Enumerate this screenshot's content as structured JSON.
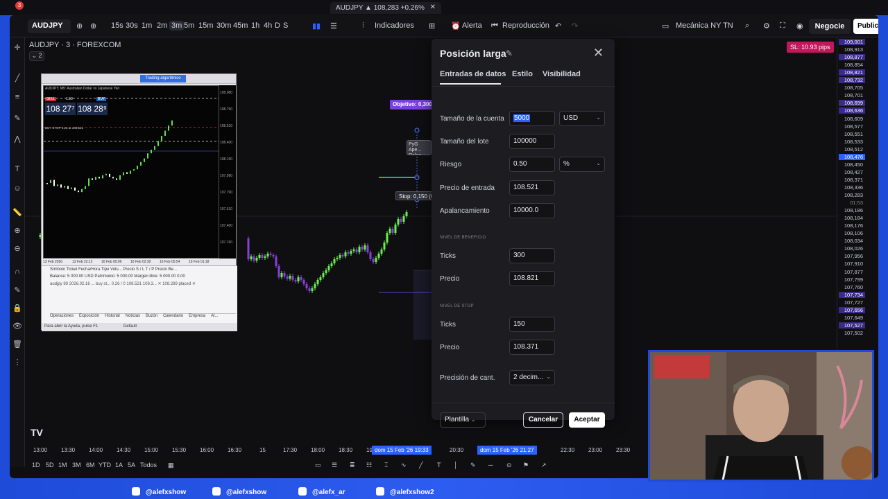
{
  "browser": {
    "tab_title": "AUDJPY ▲ 108,283 +0.26%",
    "notif_count": "3"
  },
  "toolbar": {
    "symbol": "AUDJPY",
    "timeframes": [
      "15s",
      "30s",
      "1m",
      "2m",
      "3m",
      "5m",
      "15m",
      "30m",
      "45m",
      "1h",
      "4h",
      "D",
      "S"
    ],
    "active_tf": "3m",
    "indicators_label": "Indicadores",
    "alert_label": "Alerta",
    "replay_label": "Reproducción",
    "layout_name": "Mecánica NY TN",
    "trade_label": "Negocie",
    "publish_label": "Publica"
  },
  "chart": {
    "title": "AUDJPY · 3 · FOREXCOM",
    "collapse_count": "2",
    "objective_label": "Objetivo: 0,300",
    "stop_label": "Stop: 0,150 (0",
    "pyg_label": "PyG Ape... Relac...",
    "sl_badge": "SL: 10.93 pips",
    "price_labels": [
      "109,001",
      "108,913",
      "108,877",
      "108,854",
      "108,821",
      "108,732",
      "108,705",
      "108,701",
      "108,699",
      "108,636",
      "108,609",
      "108,577",
      "108,551",
      "108,533",
      "108,512",
      "108,476",
      "108,450",
      "108,427",
      "108,371",
      "108,336",
      "108,283",
      "01:53",
      "108,186",
      "108,184",
      "108,176",
      "108,106",
      "108,034",
      "108,026",
      "107,956",
      "107,910",
      "107,877",
      "107,799",
      "107,760",
      "107,734",
      "107,727",
      "107,656",
      "107,649",
      "107,527",
      "107,502"
    ],
    "time_labels": [
      "13:00",
      "13:30",
      "14:00",
      "14:30",
      "15:00",
      "15:30",
      "16:00",
      "16:30",
      "15",
      "17:30",
      "18:00",
      "18:30",
      "19",
      "20:30",
      "21",
      "22:30",
      "23:00",
      "23:30"
    ],
    "crosshair_time_1": "dom 15 Feb '26  19:33",
    "crosshair_time_2": "dom 15 Feb '26  21:27",
    "ranges": [
      "1D",
      "5D",
      "1M",
      "3M",
      "6M",
      "YTD",
      "1A",
      "5A",
      "Todos"
    ]
  },
  "mt5": {
    "header": "AUDJPY, M5: Australian Dollar vs Japanese Yen",
    "sell_label": "SELL",
    "buy_label": "BUY",
    "lot": "1.50",
    "bid": "108 27⁷",
    "ask": "108 28⁹",
    "buystop_label": "BUY STOP 0.26 at 108.521",
    "algo_label": "Trading algorítmico",
    "dates": [
      "13 Feb 2026",
      "13 Feb 22:12",
      "16 Feb 00:06",
      "16 Feb 02:30",
      "16 Feb 05:54",
      "16 Feb 01:18"
    ],
    "axis": [
      "108.980",
      "108.790",
      "108.610",
      "108.400",
      "108.190",
      "107.990",
      "107.790",
      "107.610",
      "107.400",
      "107.190"
    ],
    "cols": "Símbolo     Ticket    Fecha/Hora     Tipo    Volu...   Precio    S / L    T / P   Precio    Be...",
    "balance_line": "Balance: 5 000.00 USD  Patrimonio: 5 000.00  Margen libre: 5 000.00        0.00",
    "order_line": "audjpy    89    2026.02.16 ...  buy st...   0.26 / 0   108.521  108.3...  ✕  108.289  placed  ✕",
    "tabs": [
      "Operaciones",
      "Exposición",
      "Historial",
      "Noticias",
      "Buzón",
      "Calendario",
      "Empresa",
      "Al..."
    ],
    "status_left": "Para abrir la Ayuda, pulse F1",
    "status_right": "Default"
  },
  "dialog": {
    "title": "Posición larga",
    "tabs": [
      "Entradas de datos",
      "Estilo",
      "Visibilidad"
    ],
    "account_size_label": "Tamaño de la cuenta",
    "account_size": "5000",
    "currency": "USD",
    "lot_size_label": "Tamaño del lote",
    "lot_size": "100000",
    "risk_label": "Riesgo",
    "risk": "0.50",
    "risk_unit": "%",
    "entry_label": "Precio de entrada",
    "entry": "108.521",
    "leverage_label": "Apalancamiento",
    "leverage": "10000.0",
    "profit_section": "NIVEL DE BENEFICIO",
    "profit_ticks_label": "Ticks",
    "profit_ticks": "300",
    "profit_price_label": "Precio",
    "profit_price": "108.821",
    "stop_section": "NIVEL DE STOP",
    "stop_ticks_label": "Ticks",
    "stop_ticks": "150",
    "stop_price_label": "Precio",
    "stop_price": "108.371",
    "precision_label": "Precisión de cant.",
    "precision": "2 decim...",
    "template_label": "Plantilla",
    "cancel_label": "Cancelar",
    "ok_label": "Aceptar"
  },
  "socials": [
    "@alefxshow",
    "@alefxshow",
    "@alefx_ar",
    "@alefxshow2"
  ]
}
